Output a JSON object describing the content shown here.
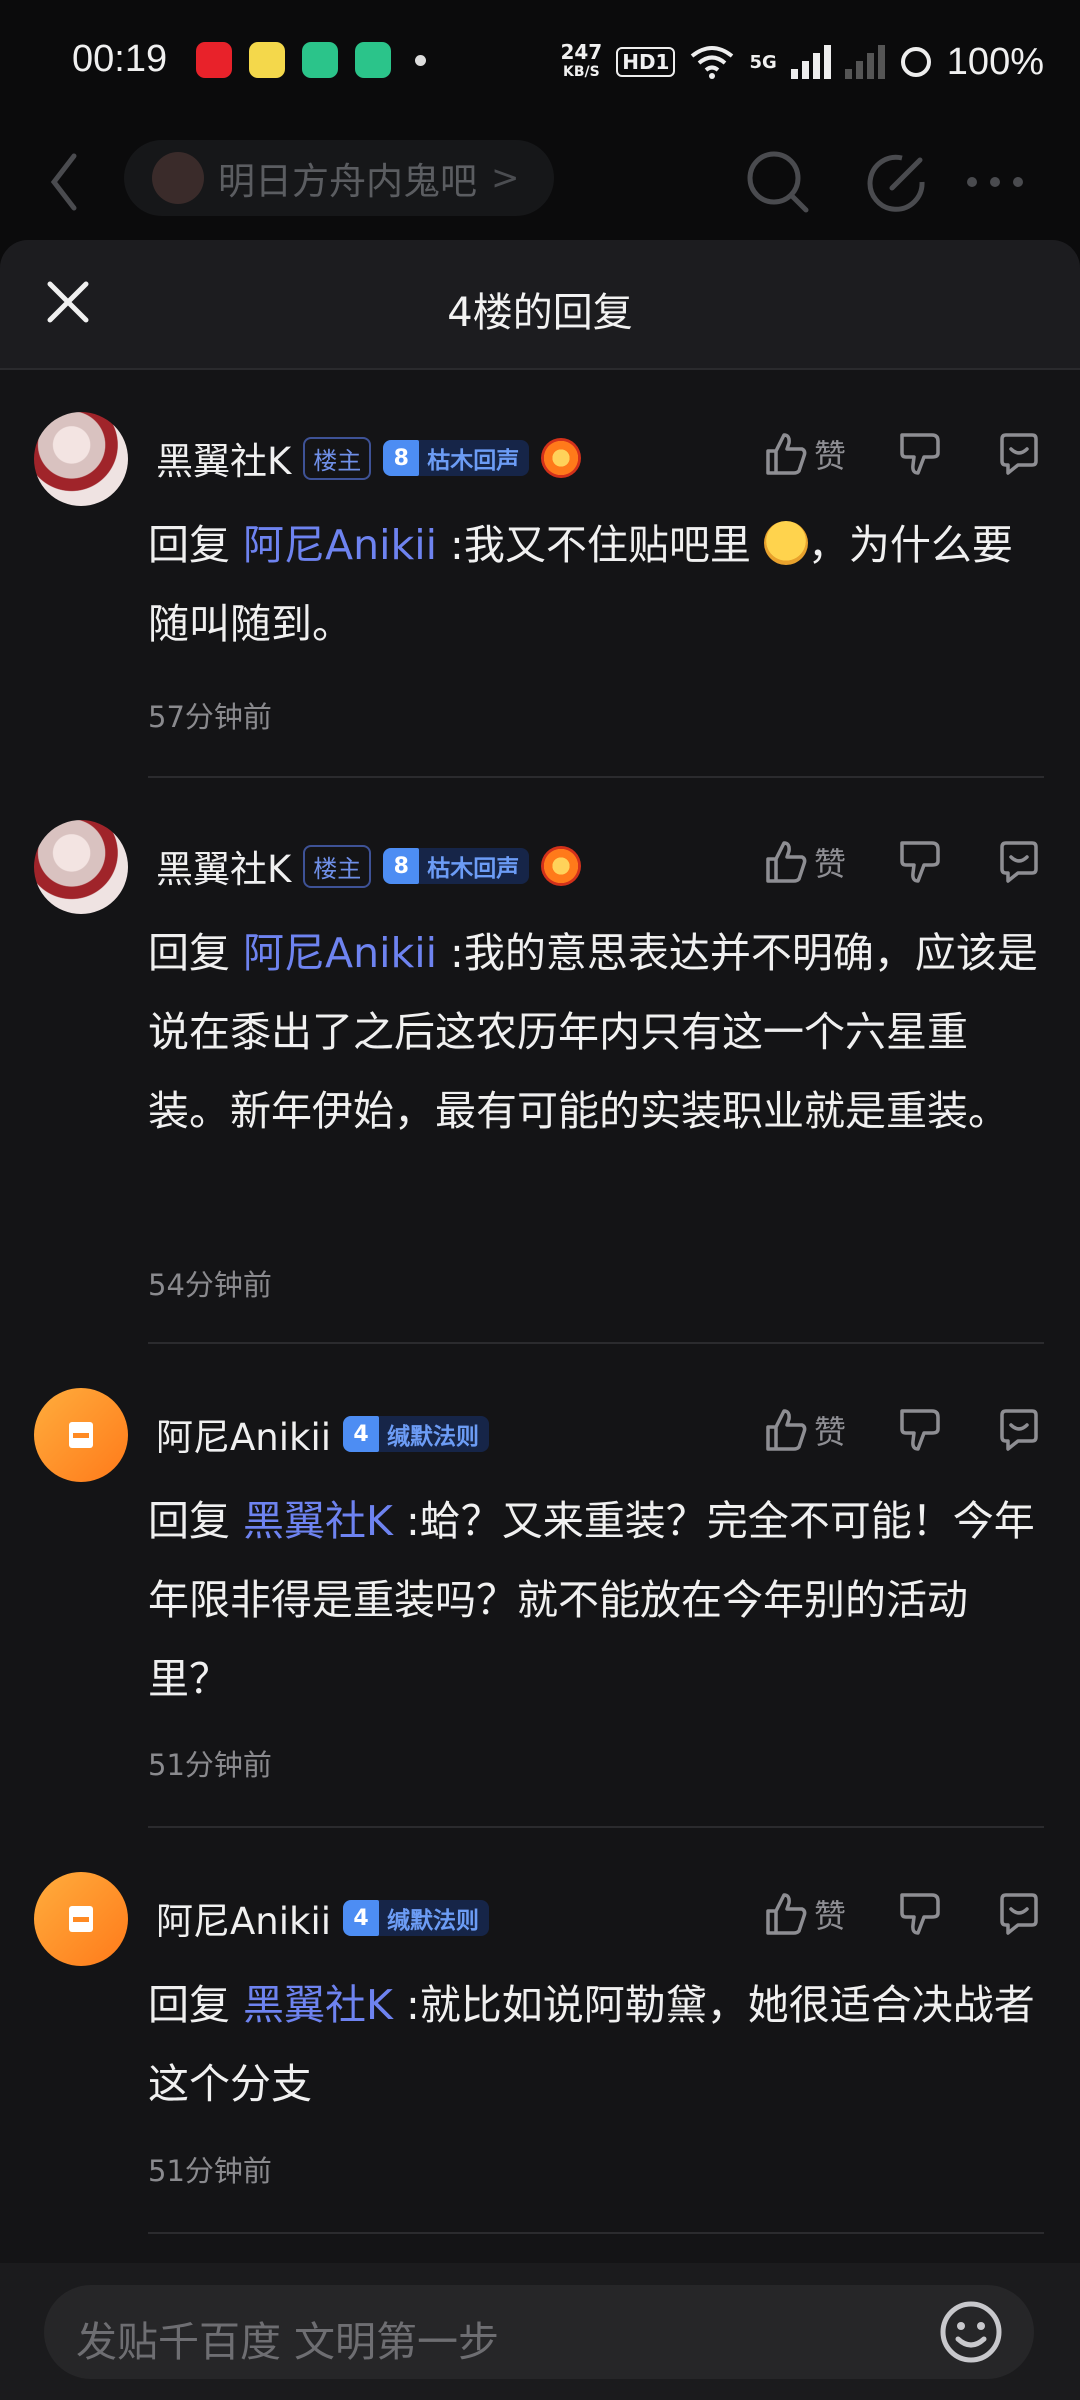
{
  "status_bar": {
    "time": "00:19",
    "net_speed_value": "247",
    "net_speed_unit": "KB/S",
    "hd_label": "HD1",
    "network_label": "5G",
    "battery": "100%"
  },
  "topnav": {
    "forum_name": "明日方舟内鬼吧",
    "forum_chevron": ">"
  },
  "sheet": {
    "title": "4楼的回复"
  },
  "replies": [
    {
      "username": "黑翼社K",
      "owner_tag": "楼主",
      "level": "8",
      "level_name": "枯木回声",
      "like_label": "赞",
      "prefix": "回复 ",
      "mention": "阿尼Anikii",
      "text_before_emoji": " :我又不住贴吧里 ",
      "text_after_emoji": "，为什么要随叫随到。",
      "time": "57分钟前"
    },
    {
      "username": "黑翼社K",
      "owner_tag": "楼主",
      "level": "8",
      "level_name": "枯木回声",
      "like_label": "赞",
      "prefix": "回复 ",
      "mention": "阿尼Anikii",
      "text": " :我的意思表达并不明确，应该是说在黍出了之后这农历年内只有这一个六星重装。新年伊始，最有可能的实装职业就是重装。",
      "time": "54分钟前"
    },
    {
      "username": "阿尼Anikii",
      "level": "4",
      "level_name": "缄默法则",
      "like_label": "赞",
      "prefix": "回复 ",
      "mention": "黑翼社K",
      "text": " :蛤？又来重装？完全不可能！今年年限非得是重装吗？就不能放在今年别的活动里？",
      "time": "51分钟前"
    },
    {
      "username": "阿尼Anikii",
      "level": "4",
      "level_name": "缄默法则",
      "like_label": "赞",
      "prefix": "回复 ",
      "mention": "黑翼社K",
      "text": " :就比如说阿勒黛，她很适合决战者这个分支",
      "time": "51分钟前"
    }
  ],
  "input": {
    "placeholder": "发贴千百度 文明第一步"
  },
  "colors": {
    "mention": "#6e83f0",
    "level_badge": "#4d8df3",
    "avatar_orange": "#ff8a23"
  }
}
